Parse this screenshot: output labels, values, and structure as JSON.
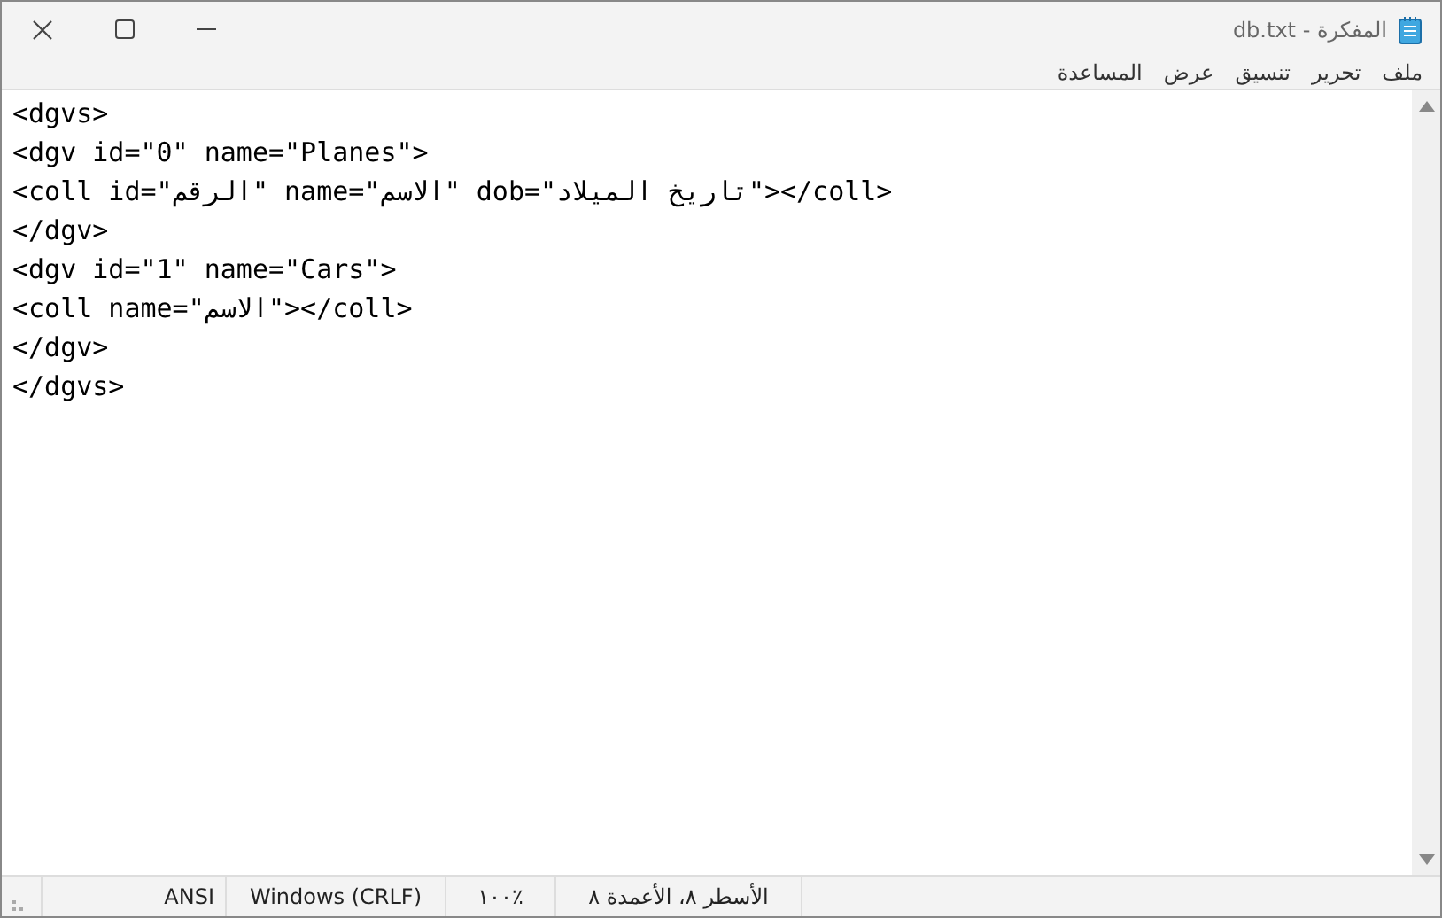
{
  "window": {
    "title": "المفكرة - db.txt"
  },
  "menu": [
    {
      "label": "ملف"
    },
    {
      "label": "تحرير"
    },
    {
      "label": "تنسيق"
    },
    {
      "label": "عرض"
    },
    {
      "label": "المساعدة"
    }
  ],
  "editor": {
    "lines": [
      "<dgvs>",
      "<dgv id=\"0\" name=\"Planes\">",
      "<coll id=\"الرقم\" name=\"الاسم\" dob=\"تاريخ الميلاد\"></coll>",
      "</dgv>",
      "<dgv id=\"1\" name=\"Cars\">",
      "<coll name=\"الاسم\"></coll>",
      "</dgv>",
      "</dgvs>"
    ]
  },
  "status_bar": {
    "position": "الأسطر ٨، الأعمدة ٨",
    "zoom": "١٠٠٪",
    "line_ending": "Windows (CRLF)",
    "encoding": "ANSI"
  }
}
